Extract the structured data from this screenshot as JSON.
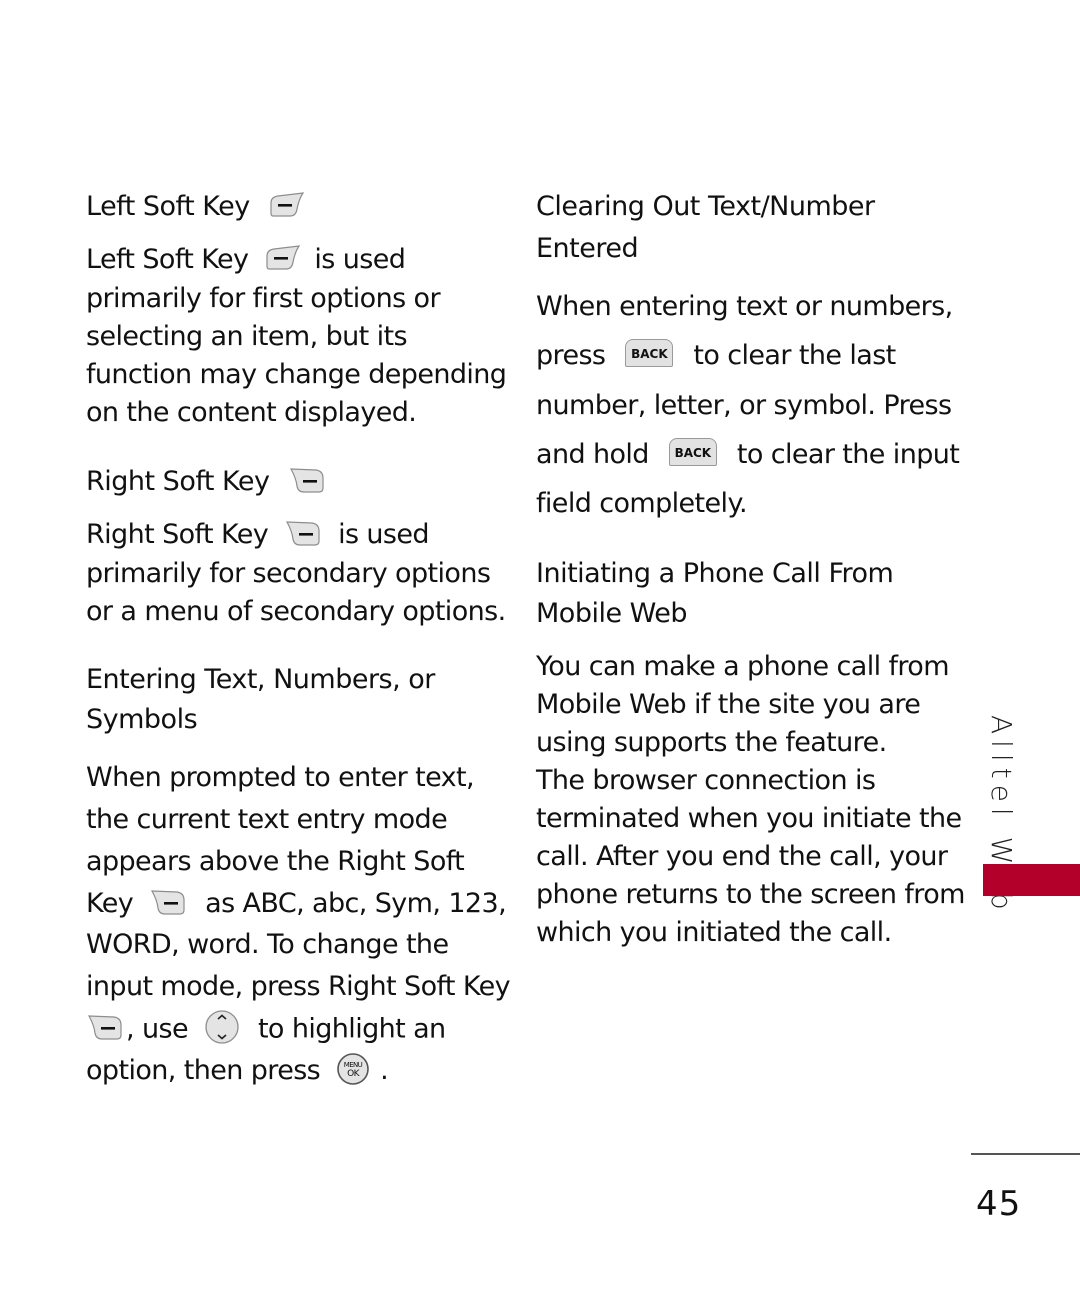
{
  "left_column": {
    "left_soft_key": {
      "heading": "Left Soft Key",
      "lines": [
        [
          "Left Soft Key",
          "is used"
        ],
        "primarily for first options or",
        "selecting an item, but its",
        "function may change depending",
        "on the content displayed."
      ]
    },
    "right_soft_key": {
      "heading": "Right Soft Key",
      "lines": [
        [
          "Right Soft Key",
          "is used"
        ],
        "primarily for secondary options",
        "or a menu of secondary options."
      ]
    },
    "entering_text": {
      "heading_lines": [
        "Entering Text, Numbers, or",
        "Symbols"
      ],
      "lines": [
        "When prompted to enter text,",
        "the current text entry mode",
        "appears above the Right Soft",
        [
          "Key",
          "as ABC, abc, Sym, 123,"
        ],
        "WORD, word. To change the",
        "input mode, press Right Soft Key",
        [
          ", use",
          "to highlight an"
        ],
        [
          "option, then press",
          "."
        ]
      ]
    }
  },
  "right_column": {
    "clearing": {
      "heading_lines": [
        "Clearing Out Text/Number",
        "Entered"
      ],
      "lines": [
        "When entering text or numbers,",
        [
          "press",
          "to clear the last"
        ],
        "number, letter, or symbol. Press",
        [
          "and hold",
          "to clear the input"
        ],
        "field completely."
      ],
      "back_key_label": "BACK"
    },
    "phone_call": {
      "heading_lines": [
        "Initiating a Phone Call From",
        "Mobile Web"
      ],
      "lines": [
        "You can make a phone call from",
        "Mobile Web if the site you are",
        "using supports the feature.",
        "The browser connection is",
        "terminated when you initiate the",
        "call. After you end the call, your",
        "phone returns to the screen from",
        "which you initiated the call."
      ]
    }
  },
  "side_tab": {
    "label": "Alltel Web",
    "color": "#b3002a"
  },
  "ok_key_labels": [
    "MENU",
    "OK"
  ],
  "page_number": "45"
}
